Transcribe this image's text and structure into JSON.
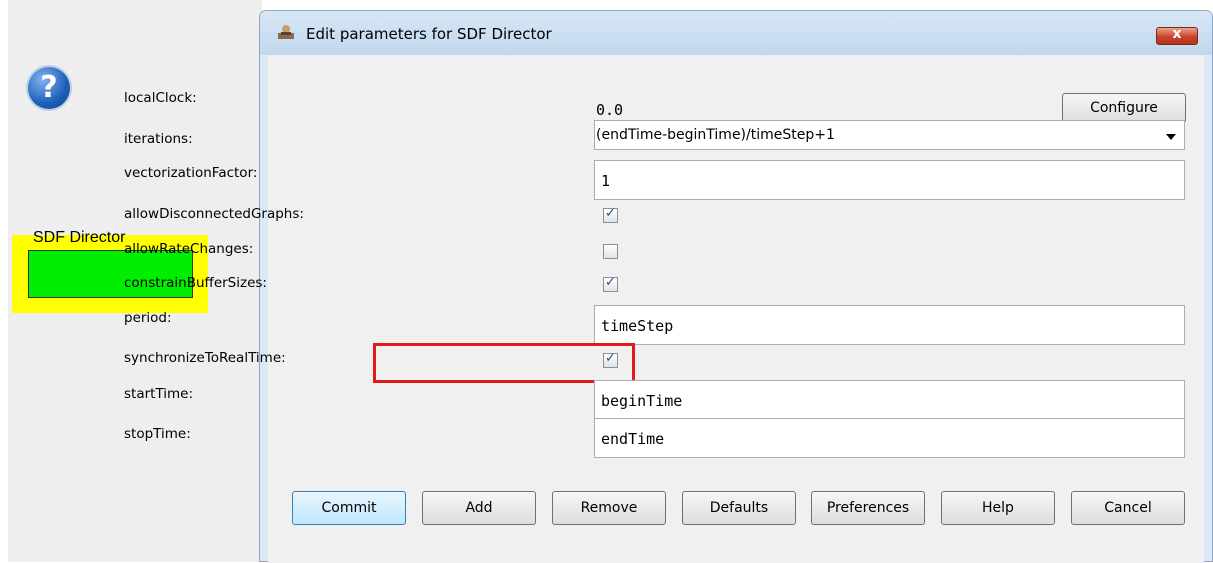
{
  "canvas": {
    "director_label": "SDF Director"
  },
  "dialog": {
    "title": "Edit parameters for SDF Director",
    "close_symbol": "x",
    "help_icon": "question-icon",
    "help_glyph": "?",
    "params": {
      "localClock": {
        "label": "localClock:",
        "value": "0.0",
        "button": "Configure"
      },
      "iterations": {
        "label": "iterations:",
        "value": "(endTime-beginTime)/timeStep+1"
      },
      "vectorizationFactor": {
        "label": "vectorizationFactor:",
        "value": "1"
      },
      "allowDisconnectedGraphs": {
        "label": "allowDisconnectedGraphs:",
        "checked": true
      },
      "allowRateChanges": {
        "label": "allowRateChanges:",
        "checked": false
      },
      "constrainBufferSizes": {
        "label": "constrainBufferSizes:",
        "checked": true
      },
      "period": {
        "label": "period:",
        "value": "timeStep"
      },
      "synchronizeToRealTime": {
        "label": "synchronizeToRealTime:",
        "checked": true
      },
      "startTime": {
        "label": "startTime:",
        "value": "beginTime"
      },
      "stopTime": {
        "label": "stopTime:",
        "value": "endTime"
      }
    },
    "check_glyph": "✓",
    "buttons": {
      "commit": "Commit",
      "add": "Add",
      "remove": "Remove",
      "defaults": "Defaults",
      "preferences": "Preferences",
      "help": "Help",
      "cancel": "Cancel"
    }
  },
  "colors": {
    "highlight": "#e41a1a",
    "director_fill": "#00ee00",
    "director_bg": "#ffff00"
  }
}
